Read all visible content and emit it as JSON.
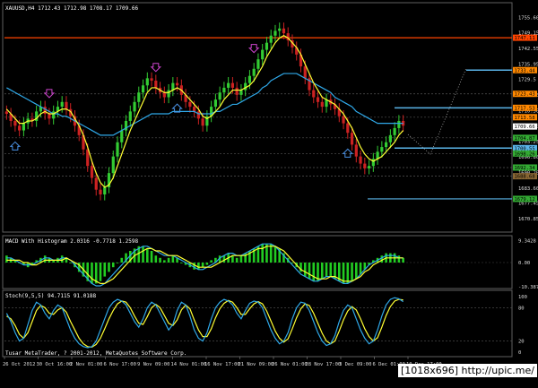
{
  "window": {
    "title": "XAUUSD,H4 1712.43 1712.98 1708.17 1709.66"
  },
  "colors": {
    "background": "#000000",
    "grid": "#3a3a3a",
    "bull_candle": "#33cc33",
    "bear_candle": "#cc2222",
    "ma_fast": "#ffff33",
    "ma_slow": "#2fa8e8",
    "level_red": "#ff4400",
    "level_blue": "#5ab4e8",
    "arrow_up": "#4a90e2",
    "arrow_down": "#cc44cc",
    "signal_line": "#ff3344",
    "histogram": "#22cc22"
  },
  "price_axis": {
    "ticks": [
      "1755.60",
      "1749.15",
      "1742.55",
      "1735.95",
      "1729.5",
      "1722.90",
      "1716.30",
      "1709.85",
      "1703.25",
      "1696.80",
      "1690.20",
      "1683.60",
      "1677.45",
      "1670.85"
    ],
    "tags": [
      {
        "text": "1747.11",
        "color": "#ff4400"
      },
      {
        "text": "1733.44",
        "color": "#ff8800"
      },
      {
        "text": "1723.43",
        "color": "#ff8800"
      },
      {
        "text": "1717.53",
        "color": "#ff8800"
      },
      {
        "text": "1713.58",
        "color": "#ff8800"
      },
      {
        "text": "1709.66",
        "color": "#ffffff"
      },
      {
        "text": "1704.87",
        "color": "#33aa33"
      },
      {
        "text": "1700.55",
        "color": "#5ab4e8"
      },
      {
        "text": "1698.26",
        "color": "#33aa33"
      },
      {
        "text": "1692.34",
        "color": "#33aa33"
      },
      {
        "text": "1688.68",
        "color": "#886633"
      },
      {
        "text": "1679.12",
        "color": "#33aa33"
      }
    ]
  },
  "macd": {
    "title": "MACD With Histogram 2.0316 -0.7718 1.2598",
    "ticks": [
      "9.3428",
      "0.00",
      "-10.3876"
    ]
  },
  "stoch": {
    "title": "Stoch(9,5,5) 94.7115 91.0188",
    "ticks": [
      "100",
      "80",
      "20",
      "0"
    ]
  },
  "time_axis": {
    "labels": [
      "26 Oct 2012",
      "30 Oct 16:00",
      "2 Nov 01:00",
      "6 Nov 17:00",
      "9 Nov 09:00",
      "14 Nov 01:00",
      "16 Nov 17:00",
      "21 Nov 09:00",
      "26 Nov 01:00",
      "28 Nov 17:00",
      "3 Dec 09:00",
      "6 Dec 01:00",
      "10 Dec 17:00"
    ]
  },
  "footer": {
    "copyright": "Tusar MetaTrader, ? 2001-2012, MetaQuotes Software Corp.",
    "watermark": "[1018x696] http://upic.me/"
  },
  "chart_data": {
    "type": "candlestick",
    "symbol": "XAUUSD",
    "timeframe": "H4",
    "ylim": [
      1667,
      1760
    ],
    "closes": [
      1715,
      1712,
      1710,
      1708,
      1711,
      1713,
      1712,
      1716,
      1718,
      1715,
      1713,
      1716,
      1718,
      1720,
      1717,
      1714,
      1710,
      1706,
      1700,
      1693,
      1688,
      1683,
      1681,
      1684,
      1690,
      1697,
      1703,
      1708,
      1712,
      1716,
      1720,
      1724,
      1727,
      1730,
      1729,
      1726,
      1724,
      1722,
      1725,
      1728,
      1727,
      1723,
      1720,
      1718,
      1716,
      1713,
      1710,
      1714,
      1718,
      1721,
      1724,
      1726,
      1728,
      1726,
      1723,
      1725,
      1728,
      1731,
      1734,
      1738,
      1742,
      1745,
      1748,
      1750,
      1751,
      1749,
      1746,
      1743,
      1740,
      1735,
      1730,
      1725,
      1722,
      1720,
      1718,
      1721,
      1719,
      1717,
      1714,
      1711,
      1707,
      1702,
      1697,
      1694,
      1692,
      1693,
      1696,
      1699,
      1701,
      1703,
      1706,
      1709,
      1712,
      1710
    ],
    "ma_fast": [
      1717,
      1715,
      1713,
      1711,
      1711,
      1712,
      1712,
      1713,
      1715,
      1716,
      1715,
      1715,
      1716,
      1717,
      1717,
      1716,
      1713,
      1710,
      1706,
      1701,
      1695,
      1690,
      1686,
      1684,
      1685,
      1688,
      1693,
      1698,
      1703,
      1708,
      1712,
      1716,
      1720,
      1724,
      1726,
      1726,
      1725,
      1724,
      1724,
      1725,
      1726,
      1725,
      1723,
      1721,
      1719,
      1717,
      1714,
      1713,
      1714,
      1716,
      1718,
      1721,
      1723,
      1725,
      1725,
      1725,
      1726,
      1727,
      1729,
      1732,
      1735,
      1739,
      1742,
      1745,
      1747,
      1748,
      1747,
      1745,
      1743,
      1740,
      1736,
      1732,
      1728,
      1725,
      1722,
      1721,
      1720,
      1719,
      1717,
      1715,
      1712,
      1709,
      1705,
      1701,
      1698,
      1696,
      1695,
      1696,
      1697,
      1699,
      1701,
      1703,
      1706,
      1708
    ],
    "ma_slow": [
      1726,
      1725,
      1724,
      1723,
      1722,
      1721,
      1720,
      1719,
      1718,
      1717,
      1716,
      1715,
      1715,
      1714,
      1714,
      1713,
      1712,
      1711,
      1710,
      1709,
      1708,
      1707,
      1706,
      1706,
      1706,
      1706,
      1707,
      1708,
      1709,
      1710,
      1711,
      1712,
      1713,
      1714,
      1715,
      1715,
      1715,
      1715,
      1715,
      1716,
      1716,
      1716,
      1716,
      1716,
      1716,
      1715,
      1715,
      1715,
      1715,
      1716,
      1716,
      1717,
      1718,
      1719,
      1719,
      1720,
      1721,
      1722,
      1723,
      1724,
      1726,
      1727,
      1729,
      1730,
      1731,
      1732,
      1732,
      1732,
      1732,
      1731,
      1730,
      1729,
      1728,
      1727,
      1726,
      1725,
      1724,
      1722,
      1721,
      1720,
      1719,
      1718,
      1716,
      1715,
      1714,
      1713,
      1712,
      1711,
      1711,
      1711,
      1711,
      1711,
      1711,
      1711
    ],
    "levels": [
      1747.11,
      1733.44,
      1723.43,
      1717.53,
      1713.58,
      1704.87,
      1700.55,
      1698.26,
      1692.34,
      1688.68,
      1679.12
    ],
    "macd_hist": [
      3,
      2,
      1,
      0,
      -1,
      -2,
      -1,
      1,
      2,
      3,
      2,
      1,
      2,
      3,
      2,
      0,
      -2,
      -4,
      -6,
      -8,
      -9,
      -9,
      -8,
      -6,
      -4,
      -2,
      0,
      2,
      4,
      5,
      6,
      7,
      7,
      6,
      5,
      3,
      2,
      1,
      2,
      3,
      2,
      0,
      -1,
      -2,
      -3,
      -3,
      -2,
      -1,
      1,
      2,
      3,
      3,
      4,
      3,
      2,
      3,
      4,
      5,
      6,
      7,
      8,
      8,
      8,
      7,
      6,
      4,
      2,
      0,
      -2,
      -4,
      -6,
      -7,
      -8,
      -8,
      -7,
      -6,
      -6,
      -7,
      -8,
      -9,
      -9,
      -8,
      -7,
      -5,
      -3,
      -1,
      1,
      2,
      3,
      4,
      4,
      4,
      3,
      2
    ],
    "macd_line": [
      2,
      2,
      1,
      0,
      -1,
      -1,
      -1,
      0,
      1,
      2,
      2,
      1,
      1,
      2,
      2,
      1,
      -1,
      -3,
      -5,
      -7,
      -9,
      -10,
      -10,
      -9,
      -7,
      -5,
      -3,
      -1,
      1,
      3,
      5,
      6,
      7,
      7,
      6,
      5,
      4,
      3,
      3,
      3,
      2,
      1,
      0,
      -1,
      -2,
      -3,
      -3,
      -2,
      -1,
      0,
      2,
      3,
      4,
      4,
      3,
      3,
      4,
      5,
      6,
      7,
      8,
      8,
      8,
      7,
      5,
      3,
      1,
      -1,
      -3,
      -5,
      -6,
      -7,
      -8,
      -8,
      -7,
      -6,
      -6,
      -7,
      -8,
      -9,
      -9,
      -8,
      -7,
      -5,
      -3,
      -1,
      0,
      1,
      2,
      3,
      3,
      3,
      2,
      2
    ],
    "macd_signal": [
      1,
      1,
      1,
      1,
      0,
      0,
      -1,
      -1,
      0,
      1,
      1,
      1,
      1,
      1,
      2,
      1,
      0,
      -1,
      -3,
      -5,
      -7,
      -8,
      -9,
      -9,
      -8,
      -7,
      -5,
      -3,
      -1,
      1,
      3,
      4,
      5,
      6,
      6,
      5,
      5,
      4,
      3,
      3,
      3,
      2,
      1,
      0,
      -1,
      -2,
      -2,
      -2,
      -2,
      -1,
      0,
      1,
      2,
      3,
      3,
      3,
      3,
      4,
      5,
      6,
      6,
      7,
      7,
      7,
      6,
      5,
      3,
      1,
      -1,
      -3,
      -4,
      -5,
      -6,
      -7,
      -7,
      -7,
      -6,
      -6,
      -7,
      -8,
      -8,
      -8,
      -7,
      -6,
      -4,
      -3,
      -1,
      0,
      1,
      2,
      2,
      2,
      2,
      2
    ],
    "stoch_main": [
      70,
      55,
      35,
      20,
      25,
      50,
      75,
      90,
      85,
      70,
      60,
      75,
      85,
      80,
      60,
      40,
      25,
      15,
      10,
      8,
      10,
      20,
      40,
      60,
      80,
      90,
      95,
      92,
      85,
      70,
      55,
      45,
      60,
      80,
      90,
      85,
      70,
      55,
      40,
      50,
      75,
      90,
      85,
      65,
      40,
      25,
      20,
      35,
      60,
      80,
      90,
      95,
      92,
      85,
      70,
      60,
      75,
      88,
      92,
      90,
      80,
      60,
      40,
      25,
      15,
      20,
      35,
      60,
      80,
      90,
      88,
      75,
      55,
      35,
      20,
      12,
      15,
      30,
      55,
      75,
      85,
      80,
      60,
      40,
      25,
      15,
      20,
      40,
      65,
      85,
      95,
      98,
      96,
      91
    ],
    "stoch_signal": [
      65,
      60,
      48,
      32,
      25,
      35,
      55,
      75,
      84,
      80,
      70,
      68,
      76,
      80,
      72,
      55,
      40,
      25,
      15,
      10,
      9,
      14,
      25,
      42,
      60,
      75,
      87,
      92,
      90,
      80,
      65,
      52,
      50,
      64,
      80,
      86,
      80,
      66,
      52,
      48,
      58,
      76,
      85,
      78,
      58,
      40,
      28,
      28,
      42,
      62,
      78,
      88,
      93,
      90,
      80,
      68,
      68,
      78,
      87,
      91,
      87,
      74,
      56,
      38,
      25,
      18,
      24,
      42,
      62,
      78,
      87,
      84,
      70,
      52,
      34,
      20,
      15,
      20,
      38,
      58,
      74,
      82,
      76,
      60,
      42,
      28,
      20,
      26,
      45,
      66,
      82,
      92,
      95,
      94
    ]
  }
}
